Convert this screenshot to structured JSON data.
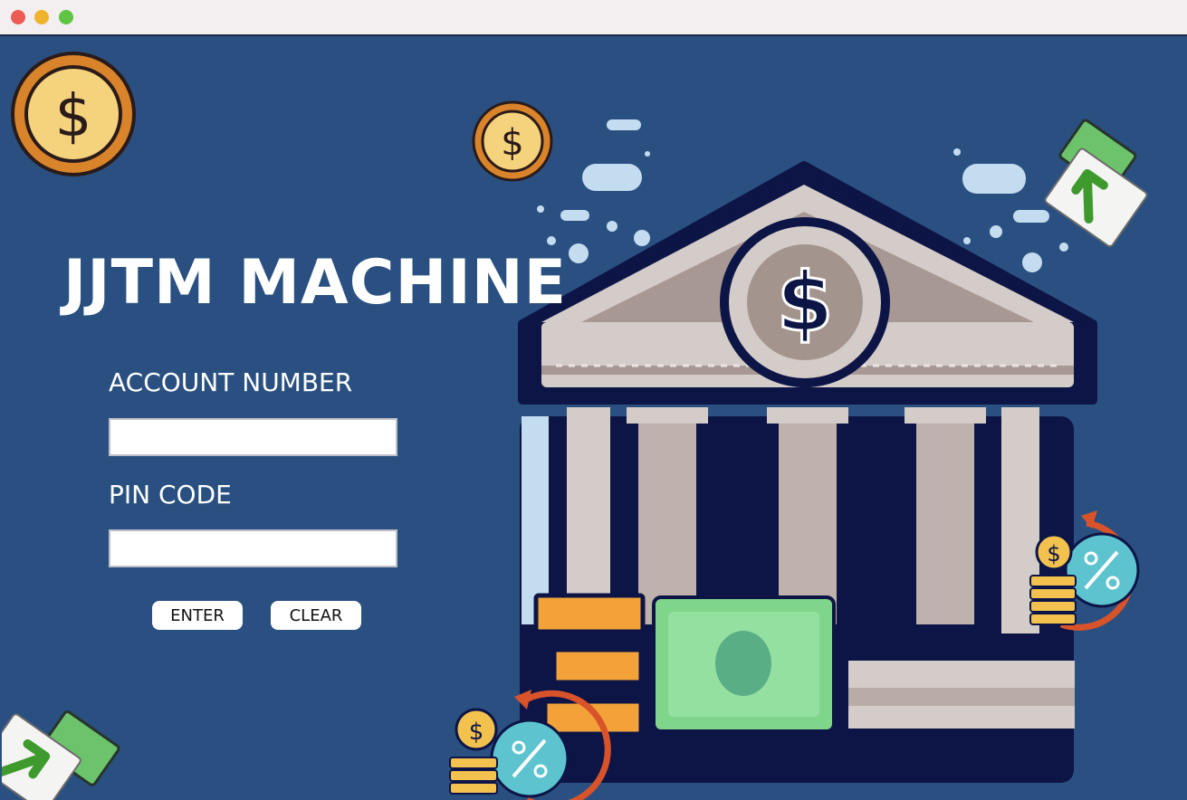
{
  "window": {
    "controls": [
      "close",
      "minimize",
      "maximize"
    ]
  },
  "app": {
    "title": "JJTM MACHINE"
  },
  "form": {
    "account_label": "ACCOUNT NUMBER",
    "account_value": "",
    "pin_label": "PIN CODE",
    "pin_value": "",
    "enter_label": "ENTER",
    "clear_label": "CLEAR"
  },
  "illustration": {
    "symbol": "$",
    "icons": [
      "bank-building-icon",
      "coin-icon",
      "banknote-arrow-icon",
      "interest-rate-icon",
      "coin-stack-icon"
    ]
  },
  "colors": {
    "background": "#2a5081",
    "navy": "#0d1546",
    "stone": "#d4ccc8",
    "gold": "#f2c14e",
    "money_green": "#7fd58a",
    "teal": "#5cc3cf",
    "orange": "#d9532a"
  }
}
